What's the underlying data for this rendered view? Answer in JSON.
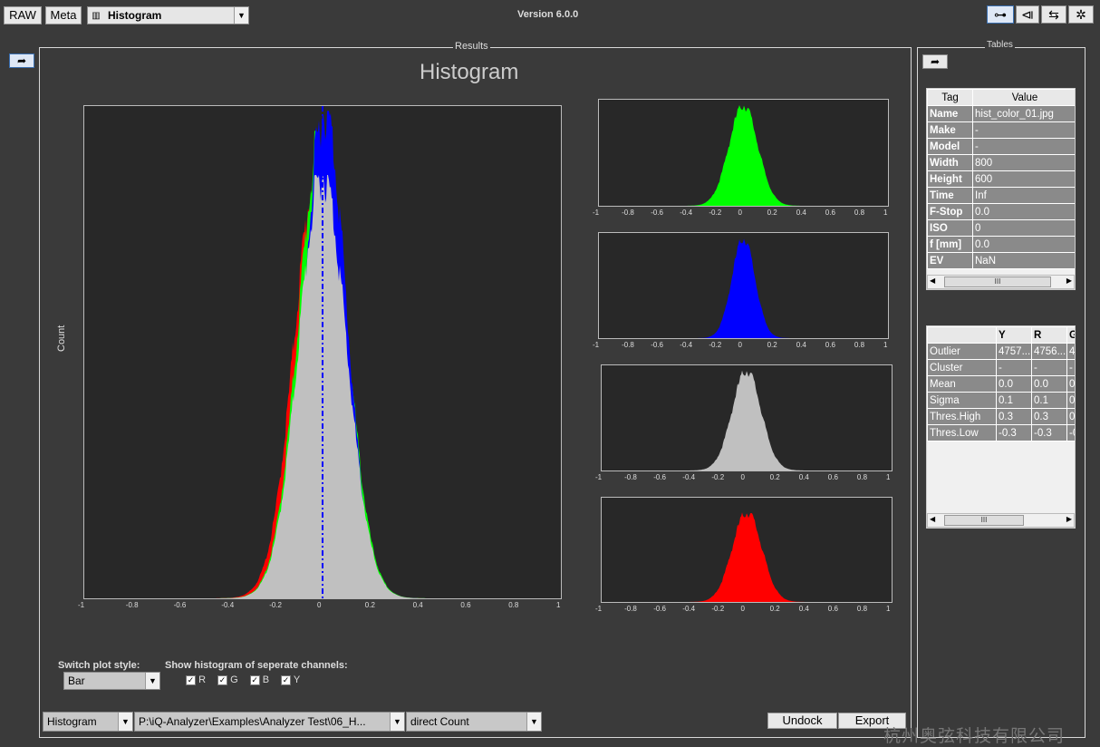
{
  "toolbar": {
    "raw_label": "RAW",
    "meta_label": "Meta",
    "module_select": "Histogram",
    "version": "Version 6.0.0"
  },
  "results": {
    "panel_title": "Results",
    "plot_title": "Histogram",
    "ylabel": "Count",
    "main_ticks": [
      "-1",
      "-0.8",
      "-0.6",
      "-0.4",
      "-0.2",
      "0",
      "0.2",
      "0.4",
      "0.6",
      "0.8",
      "1"
    ],
    "small_ticks": [
      "-1",
      "-0.8",
      "-0.6",
      "-0.4",
      "-0.2",
      "0",
      "0.2",
      "0.4",
      "0.6",
      "0.8",
      "1"
    ],
    "switch_plot_style_label": "Switch plot style:",
    "plot_style_value": "Bar",
    "channels_label": "Show histogram of seperate channels:",
    "channels": [
      {
        "name": "R",
        "checked": true
      },
      {
        "name": "G",
        "checked": true
      },
      {
        "name": "B",
        "checked": true
      },
      {
        "name": "Y",
        "checked": true
      }
    ],
    "bottom_select_1": "Histogram",
    "bottom_select_2": "P:\\iQ-Analyzer\\Examples\\Analyzer Test\\06_H...",
    "bottom_select_3": "direct Count",
    "undock_label": "Undock",
    "export_label": "Export"
  },
  "tables": {
    "panel_title": "Tables",
    "meta_headers": [
      "Tag",
      "Value"
    ],
    "meta_rows": [
      [
        "Name",
        "hist_color_01.jpg"
      ],
      [
        "Make",
        "-"
      ],
      [
        "Model",
        "-"
      ],
      [
        "Width",
        "800"
      ],
      [
        "Height",
        "600"
      ],
      [
        "Time",
        "Inf"
      ],
      [
        "F-Stop",
        "0.0"
      ],
      [
        "ISO",
        "0"
      ],
      [
        "f [mm]",
        "0.0"
      ],
      [
        "EV",
        "NaN"
      ]
    ],
    "stats_headers": [
      "",
      "Y",
      "R",
      "G"
    ],
    "stats_rows": [
      [
        "Outlier",
        "4757...",
        "4756...",
        "4"
      ],
      [
        "Cluster",
        "-",
        "-",
        "-"
      ],
      [
        "Mean",
        "0.0",
        "0.0",
        "0"
      ],
      [
        "Sigma",
        "0.1",
        "0.1",
        "0"
      ],
      [
        "Thres.High",
        "0.3",
        "0.3",
        "0"
      ],
      [
        "Thres.Low",
        "-0.3",
        "-0.3",
        "-0"
      ]
    ],
    "scroll_glyph": "III"
  },
  "watermark": "杭州奥弦科技有限公司",
  "colors": {
    "red": "#ff0000",
    "green": "#00ff00",
    "blue": "#0000ff",
    "gray": "#c0c0c0",
    "plot_bg": "#282828"
  },
  "chart_data": [
    {
      "type": "area",
      "title": "Histogram",
      "ylabel": "Count",
      "xlim": [
        -1,
        1
      ],
      "series": [
        {
          "name": "R",
          "center": -0.02,
          "sigma": 0.1
        },
        {
          "name": "G",
          "center": 0.0,
          "sigma": 0.1
        },
        {
          "name": "B",
          "center": 0.01,
          "sigma": 0.09
        },
        {
          "name": "Y",
          "center": 0.0,
          "sigma": 0.1
        }
      ]
    },
    {
      "type": "area",
      "xlim": [
        -1,
        1
      ],
      "series": [
        {
          "name": "G",
          "center": 0.0,
          "sigma": 0.1
        }
      ]
    },
    {
      "type": "area",
      "xlim": [
        -1,
        1
      ],
      "series": [
        {
          "name": "B",
          "center": 0.0,
          "sigma": 0.08
        }
      ]
    },
    {
      "type": "area",
      "xlim": [
        -1,
        1
      ],
      "series": [
        {
          "name": "Y",
          "center": 0.0,
          "sigma": 0.1
        }
      ]
    },
    {
      "type": "area",
      "xlim": [
        -1,
        1
      ],
      "series": [
        {
          "name": "R",
          "center": 0.0,
          "sigma": 0.1
        }
      ]
    }
  ]
}
